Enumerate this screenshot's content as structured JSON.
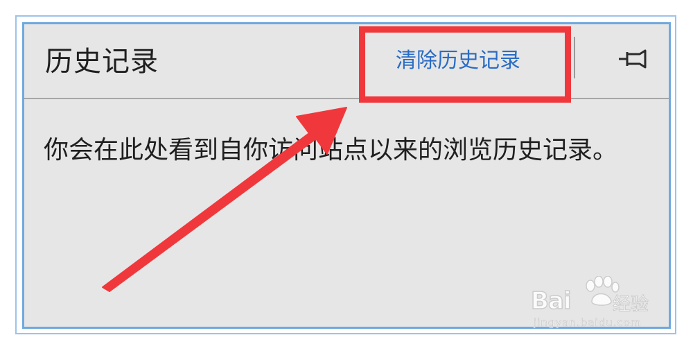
{
  "history_panel": {
    "title": "历史记录",
    "clear_history_label": "清除历史记录",
    "pin_icon": "pin-icon",
    "empty_message": "你会在此处看到自你访问站点以来的浏览历史记录。"
  },
  "annotation": {
    "highlight_color": "#f0383c"
  },
  "watermark": {
    "brand": "Bai",
    "brand_suffix": "经验",
    "url": "jingyan.baidu.com"
  },
  "colors": {
    "link": "#2a6cc4",
    "panel_bg": "#e6e6e6",
    "panel_border": "#6fa8e0"
  }
}
